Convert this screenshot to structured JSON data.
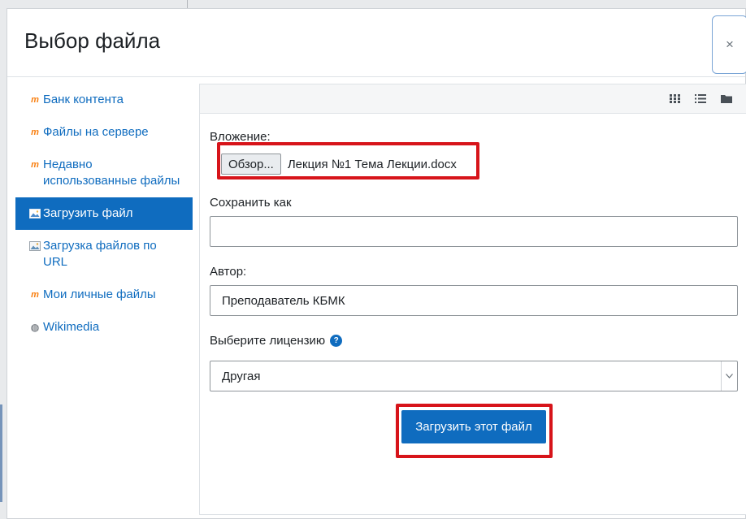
{
  "dialog": {
    "title": "Выбор файла",
    "close_icon": "×"
  },
  "sidebar": {
    "items": [
      {
        "label": "Банк контента",
        "icon": "moodle-icon",
        "active": false
      },
      {
        "label": "Файлы на сервере",
        "icon": "moodle-icon",
        "active": false
      },
      {
        "label": "Недавно использованные файлы",
        "icon": "moodle-icon",
        "active": false
      },
      {
        "label": "Загрузить файл",
        "icon": "upload-picture-icon",
        "active": true
      },
      {
        "label": "Загрузка файлов по URL",
        "icon": "url-picture-icon",
        "active": false
      },
      {
        "label": "Мои личные файлы",
        "icon": "moodle-icon",
        "active": false
      },
      {
        "label": "Wikimedia",
        "icon": "wikimedia-icon",
        "active": false
      }
    ]
  },
  "toolbar": {
    "view_icons": [
      "grid-view-icon",
      "list-view-icon",
      "folder-view-icon"
    ]
  },
  "form": {
    "attachment_label": "Вложение:",
    "browse_label": "Обзор...",
    "file_name": "Лекция №1 Тема Лекции.docx",
    "save_as_label": "Сохранить как",
    "save_as_value": "",
    "author_label": "Автор:",
    "author_value": "Преподаватель КБМК",
    "license_label": "Выберите лицензию",
    "license_value": "Другая",
    "upload_button": "Загрузить этот файл"
  },
  "colors": {
    "accent": "#0f6cbf",
    "highlight": "#d7141a",
    "moodle_orange": "#f98012"
  }
}
